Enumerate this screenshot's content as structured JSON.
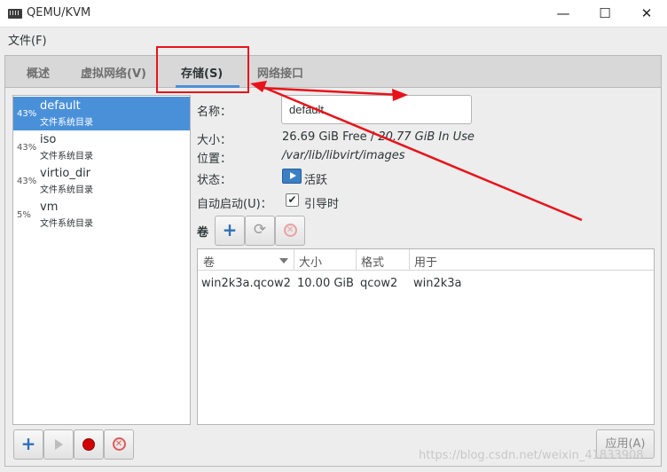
{
  "window": {
    "title": "QEMU/KVM",
    "minimize_glyph": "—",
    "maximize_glyph": "☐",
    "close_glyph": "✕"
  },
  "menu": {
    "file_label": "文件(F)"
  },
  "tabs": [
    {
      "label": "概述",
      "active": false
    },
    {
      "label": "虚拟网络(V)",
      "active": false
    },
    {
      "label": "存储(S)",
      "active": true
    },
    {
      "label": "网络接口",
      "active": false
    }
  ],
  "pools": [
    {
      "pct": "43%",
      "name": "default",
      "type": "文件系统目录",
      "selected": true
    },
    {
      "pct": "43%",
      "name": "iso",
      "type": "文件系统目录",
      "selected": false
    },
    {
      "pct": "43%",
      "name": "virtio_dir",
      "type": "文件系统目录",
      "selected": false
    },
    {
      "pct": "5%",
      "name": "vm",
      "type": "文件系统目录",
      "selected": false
    }
  ],
  "details": {
    "name_label": "名称：",
    "name_value": "default",
    "size_label": "大小：",
    "size_free": "26.69 GiB Free",
    "size_sep": " / ",
    "size_used": "20.77 GiB In Use",
    "location_label": "位置：",
    "location_value": "/var/lib/libvirt/images",
    "state_label": "状态：",
    "state_value": "活跃",
    "autostart_label": "自动启动(U)：",
    "autostart_value": "引导时",
    "autostart_checked": "✔"
  },
  "volumes": {
    "label": "卷",
    "toolbar": {
      "add_glyph": "+",
      "refresh_glyph": "⟳",
      "delete_glyph": "✕"
    },
    "columns": [
      "卷",
      "大小",
      "格式",
      "用于"
    ],
    "rows": [
      {
        "name": "win2k3a.qcow2",
        "size": "10.00 GiB",
        "format": "qcow2",
        "used_by": "win2k3a"
      }
    ]
  },
  "bottom_toolbar": {
    "add_glyph": "+",
    "delete_glyph": "✕"
  },
  "apply_label": "应用(A)",
  "watermark": "https://blog.csdn.net/weixin_41833908",
  "annotation_color": "#e8131a",
  "accent_color": "#4a90d9"
}
